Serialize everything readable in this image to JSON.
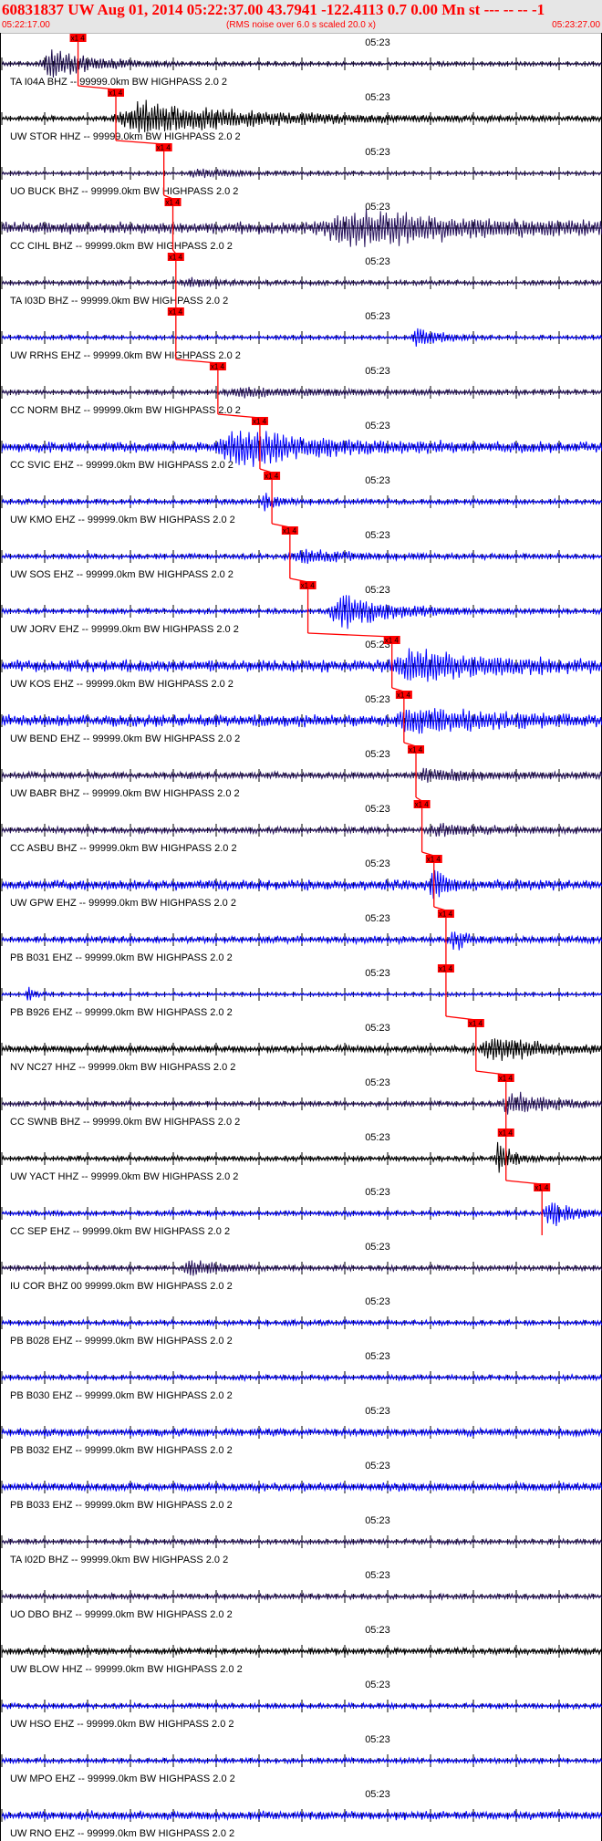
{
  "header": {
    "title": "60831837 UW Aug 01, 2014 05:22:37.00   43.7941 -122.4113  0.7 0.00 Mn st --- -- --  -1",
    "start_time": "05:22:17.00",
    "rms_note": "(RMS noise over 6.0 s scaled 20.0 x)",
    "end_time": "05:23:27.00"
  },
  "colors": {
    "header_text": "#ff0000",
    "pick": "#ff0000",
    "axis": "#000000"
  },
  "chart_data": {
    "type": "line",
    "time_range": [
      "05:22:17.00",
      "05:23:27.00"
    ],
    "minute_tick_label": "05:23",
    "pick_label": "x1 4",
    "traces": [
      {
        "label": "TA I04A BHZ -- 99999.0km BW  HIGHPASS  2.0  2",
        "color": "#1a0a4a",
        "noise": 0.12,
        "event_start": 0.06,
        "event_amp": 0.9,
        "event_dur": 0.15,
        "pick": 0.127
      },
      {
        "label": "UW STOR HHZ -- 99999.0km BW  HIGHPASS  2.0  2",
        "color": "#000000",
        "noise": 0.15,
        "event_start": 0.18,
        "event_amp": 1.0,
        "event_dur": 0.4,
        "pick": 0.19
      },
      {
        "label": "UO BUCK BHZ -- 99999.0km BW  HIGHPASS  2.0  2",
        "color": "#2a1660",
        "noise": 0.1,
        "event_start": 0.3,
        "event_amp": 0.2,
        "event_dur": 0.2,
        "pick": 0.27
      },
      {
        "label": "CC CIHL BHZ -- 99999.0km BW  HIGHPASS  2.0  2",
        "color": "#2a1660",
        "noise": 0.35,
        "event_start": 0.52,
        "event_amp": 0.95,
        "event_dur": 0.45,
        "pick": 0.285
      },
      {
        "label": "TA I03D BHZ -- 99999.0km BW  HIGHPASS  2.0  2",
        "color": "#2a1660",
        "noise": 0.14,
        "event_start": 0.3,
        "event_amp": 0.2,
        "event_dur": 0.1,
        "pick": 0.29
      },
      {
        "label": "UW RRHS EHZ -- 99999.0km BW  HIGHPASS  2.0  2",
        "color": "#0000ff",
        "noise": 0.12,
        "event_start": 0.68,
        "event_amp": 0.6,
        "event_dur": 0.08,
        "pick": 0.29
      },
      {
        "label": "CC NORM BHZ -- 99999.0km BW  HIGHPASS  2.0  2",
        "color": "#2a1660",
        "noise": 0.14,
        "event_start": 0.36,
        "event_amp": 0.25,
        "event_dur": 0.3,
        "pick": 0.36
      },
      {
        "label": "CC SVIC EHZ -- 99999.0km BW  HIGHPASS  2.0  2",
        "color": "#0000ff",
        "noise": 0.3,
        "event_start": 0.35,
        "event_amp": 1.0,
        "event_dur": 0.3,
        "pick": 0.43
      },
      {
        "label": "UW KMO EHZ -- 99999.0km BW  HIGHPASS  2.0  2",
        "color": "#0000ff",
        "noise": 0.15,
        "event_start": 0.43,
        "event_amp": 0.5,
        "event_dur": 0.05,
        "pick": 0.45
      },
      {
        "label": "UW SOS EHZ -- 99999.0km BW  HIGHPASS  2.0  2",
        "color": "#0000ff",
        "noise": 0.15,
        "event_start": 0.47,
        "event_amp": 0.35,
        "event_dur": 0.2,
        "pick": 0.48
      },
      {
        "label": "UW JORV EHZ -- 99999.0km BW  HIGHPASS  2.0  2",
        "color": "#0000ff",
        "noise": 0.15,
        "event_start": 0.54,
        "event_amp": 1.0,
        "event_dur": 0.18,
        "pick": 0.51
      },
      {
        "label": "UW KOS EHZ -- 99999.0km BW  HIGHPASS  2.0  2",
        "color": "#0000ff",
        "noise": 0.35,
        "event_start": 0.64,
        "event_amp": 0.8,
        "event_dur": 0.3,
        "pick": 0.65
      },
      {
        "label": "UW BEND EHZ -- 99999.0km BW  HIGHPASS  2.0  2",
        "color": "#0000ff",
        "noise": 0.35,
        "event_start": 0.65,
        "event_amp": 0.7,
        "event_dur": 0.25,
        "pick": 0.67
      },
      {
        "label": "UW BABR BHZ -- 99999.0km BW  HIGHPASS  2.0  2",
        "color": "#2a1660",
        "noise": 0.2,
        "event_start": 0.68,
        "event_amp": 0.3,
        "event_dur": 0.2,
        "pick": 0.69
      },
      {
        "label": "CC ASBU BHZ -- 99999.0km BW  HIGHPASS  2.0  2",
        "color": "#2a1660",
        "noise": 0.18,
        "event_start": 0.7,
        "event_amp": 0.3,
        "event_dur": 0.2,
        "pick": 0.7
      },
      {
        "label": "UW GPW EHZ -- 99999.0km BW  HIGHPASS  2.0  2",
        "color": "#0000ff",
        "noise": 0.3,
        "event_start": 0.71,
        "event_amp": 1.0,
        "event_dur": 0.05,
        "pick": 0.72
      },
      {
        "label": "PB B031 EHZ -- 99999.0km BW  HIGHPASS  2.0  2",
        "color": "#0000ff",
        "noise": 0.2,
        "event_start": 0.745,
        "event_amp": 0.8,
        "event_dur": 0.04,
        "pick": 0.74
      },
      {
        "label": "PB B926 EHZ -- 99999.0km BW  HIGHPASS  2.0  2",
        "color": "#0000ff",
        "noise": 0.1,
        "event_start": 0.04,
        "event_amp": 0.6,
        "event_dur": 0.02,
        "pick": 0.74
      },
      {
        "label": "NV NC27 HHZ -- 99999.0km BW  HIGHPASS  2.0  2",
        "color": "#000000",
        "noise": 0.2,
        "event_start": 0.79,
        "event_amp": 0.7,
        "event_dur": 0.18,
        "pick": 0.79
      },
      {
        "label": "CC SWNB BHZ -- 99999.0km BW  HIGHPASS  2.0  2",
        "color": "#2a1660",
        "noise": 0.15,
        "event_start": 0.83,
        "event_amp": 0.8,
        "event_dur": 0.12,
        "pick": 0.84
      },
      {
        "label": "UW YACT HHZ -- 99999.0km BW  HIGHPASS  2.0  2",
        "color": "#000000",
        "noise": 0.15,
        "event_start": 0.82,
        "event_amp": 1.0,
        "event_dur": 0.05,
        "pick": 0.84
      },
      {
        "label": "CC SEP EHZ -- 99999.0km BW  HIGHPASS  2.0  2",
        "color": "#0000ff",
        "noise": 0.15,
        "event_start": 0.9,
        "event_amp": 0.8,
        "event_dur": 0.08,
        "pick": 0.9
      },
      {
        "label": "IU COR BHZ 00 99999.0km BW  HIGHPASS  2.0  2",
        "color": "#2a1660",
        "noise": 0.15,
        "event_start": 0.3,
        "event_amp": 0.5,
        "event_dur": 0.1,
        "pick": null
      },
      {
        "label": "PB B028 EHZ -- 99999.0km BW  HIGHPASS  2.0  2",
        "color": "#0000ff",
        "noise": 0.15,
        "event_start": 0,
        "event_amp": 0,
        "event_dur": 0,
        "pick": null
      },
      {
        "label": "PB B030 EHZ -- 99999.0km BW  HIGHPASS  2.0  2",
        "color": "#0000ff",
        "noise": 0.15,
        "event_start": 0,
        "event_amp": 0,
        "event_dur": 0,
        "pick": null
      },
      {
        "label": "PB B032 EHZ -- 99999.0km BW  HIGHPASS  2.0  2",
        "color": "#0000ff",
        "noise": 0.22,
        "event_start": 0,
        "event_amp": 0,
        "event_dur": 0,
        "pick": null
      },
      {
        "label": "PB B033 EHZ -- 99999.0km BW  HIGHPASS  2.0  2",
        "color": "#0000ff",
        "noise": 0.25,
        "event_start": 0,
        "event_amp": 0,
        "event_dur": 0,
        "pick": null
      },
      {
        "label": "TA I02D BHZ -- 99999.0km BW  HIGHPASS  2.0  2",
        "color": "#2a1660",
        "noise": 0.15,
        "event_start": 0,
        "event_amp": 0,
        "event_dur": 0,
        "pick": null
      },
      {
        "label": "UO DBO BHZ -- 99999.0km BW  HIGHPASS  2.0  2",
        "color": "#2a1660",
        "noise": 0.15,
        "event_start": 0,
        "event_amp": 0,
        "event_dur": 0,
        "pick": null
      },
      {
        "label": "UW BLOW HHZ -- 99999.0km BW  HIGHPASS  2.0  2",
        "color": "#000000",
        "noise": 0.18,
        "event_start": 0,
        "event_amp": 0,
        "event_dur": 0,
        "pick": null
      },
      {
        "label": "UW HSO EHZ -- 99999.0km BW  HIGHPASS  2.0  2",
        "color": "#0000ff",
        "noise": 0.15,
        "event_start": 0,
        "event_amp": 0,
        "event_dur": 0,
        "pick": null
      },
      {
        "label": "UW MPO EHZ -- 99999.0km BW  HIGHPASS  2.0  2",
        "color": "#0000ff",
        "noise": 0.15,
        "event_start": 0,
        "event_amp": 0,
        "event_dur": 0,
        "pick": null
      },
      {
        "label": "UW RNO EHZ -- 99999.0km BW  HIGHPASS  2.0  2",
        "color": "#0000ff",
        "noise": 0.25,
        "event_start": 0,
        "event_amp": 0,
        "event_dur": 0,
        "pick": null
      }
    ]
  }
}
